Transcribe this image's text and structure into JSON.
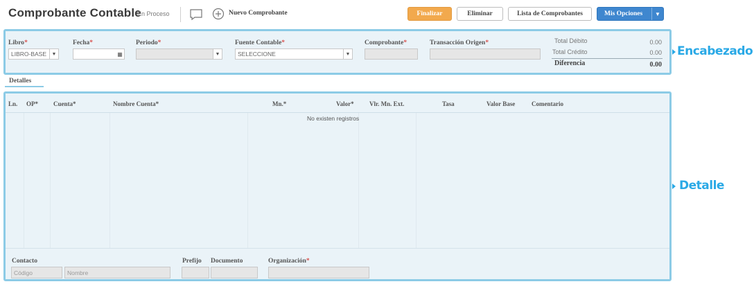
{
  "header": {
    "title": "Comprobante Contable",
    "status": "En Proceso",
    "new_label": "Nuevo Comprobante",
    "buttons": {
      "finalizar": "Finalizar",
      "eliminar": "Eliminar",
      "lista": "Lista de Comprobantes",
      "opciones": "Mis Opciones"
    }
  },
  "form": {
    "libro": {
      "label": "Libro",
      "value": "LIBRO-BASE"
    },
    "fecha": {
      "label": "Fecha",
      "value": ""
    },
    "periodo": {
      "label": "Periodo",
      "value": ""
    },
    "fuente": {
      "label": "Fuente Contable",
      "value": "SELECCIONE"
    },
    "comprobante": {
      "label": "Comprobante",
      "value": ""
    },
    "transaccion": {
      "label": "Transacción Origen",
      "value": ""
    },
    "required_mark": "*"
  },
  "totals": {
    "debito_label": "Total Débito",
    "debito": "0.00",
    "credito_label": "Total Crédito",
    "credito": "0.00",
    "diferencia_label": "Diferencia",
    "diferencia": "0.00"
  },
  "annotations": {
    "encabezado": "Encabezado",
    "detalle": "Detalle"
  },
  "tabs": {
    "detalles": "Detalles"
  },
  "grid": {
    "columns": [
      "Ln.",
      "OP*",
      "Cuenta*",
      "Nombre Cuenta*",
      "Mn.*",
      "Valor*",
      "Vlr. Mn. Ext.",
      "Tasa",
      "Valor Base",
      "Comentario"
    ],
    "empty": "No existen registros"
  },
  "footer": {
    "contacto": "Contacto",
    "codigo_ph": "Código",
    "nombre_ph": "Nombre",
    "prefijo": "Prefijo",
    "documento": "Documento",
    "organizacion": "Organización",
    "required_mark": "*"
  },
  "colors": {
    "accent": "#3f87cf",
    "warning": "#f2a94d",
    "panel_border": "#8ccbe6",
    "annotation": "#2aa9e6"
  },
  "icons": [
    "comment-icon",
    "plus-circle-icon",
    "calendar-icon",
    "chevron-down-icon"
  ]
}
